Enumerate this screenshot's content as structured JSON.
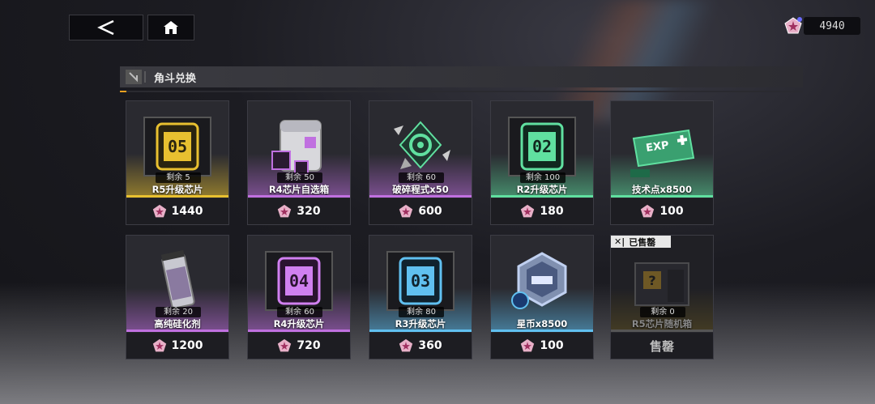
{
  "nav": {
    "back_icon": "chevron-left-icon",
    "home_icon": "home-icon"
  },
  "currency": {
    "icon": "pentagon-star-icon",
    "value": "4940"
  },
  "header": {
    "title": "角斗兑换"
  },
  "items": [
    {
      "name": "R5升级芯片",
      "stock": "剩余  5",
      "price": "1440",
      "color": "#e8c030",
      "icon": "chip-05-icon",
      "chip_label": "05"
    },
    {
      "name": "R4芯片自选箱",
      "stock": "剩余  50",
      "price": "320",
      "color": "#c070e0",
      "icon": "chip-box-icon"
    },
    {
      "name": "破碎程式x50",
      "stock": "剩余  60",
      "price": "600",
      "color": "#c070e0",
      "icon": "gear-shard-icon"
    },
    {
      "name": "R2升级芯片",
      "stock": "剩余  100",
      "price": "180",
      "color": "#60e0a0",
      "icon": "chip-02-icon",
      "chip_label": "02"
    },
    {
      "name": "技术点x8500",
      "stock": "",
      "price": "100",
      "color": "#60e0a0",
      "icon": "exp-ticket-icon",
      "exp_label": "EXP"
    },
    {
      "name": "高纯硅化剂",
      "stock": "剩余  20",
      "price": "1200",
      "color": "#c070e0",
      "icon": "silicon-vial-icon"
    },
    {
      "name": "R4升级芯片",
      "stock": "剩余  60",
      "price": "720",
      "color": "#c070e0",
      "icon": "chip-04-icon",
      "chip_label": "04"
    },
    {
      "name": "R3升级芯片",
      "stock": "剩余  80",
      "price": "360",
      "color": "#60c0f0",
      "icon": "chip-03-icon",
      "chip_label": "03"
    },
    {
      "name": "星币x8500",
      "stock": "",
      "price": "100",
      "color": "#60c0f0",
      "icon": "star-coin-icon"
    },
    {
      "name": "R5芯片随机箱",
      "stock": "剩余  0",
      "price": "售罄",
      "color": "#e8c030",
      "icon": "random-box-icon",
      "sold_out": true,
      "sold_out_tag": "已售罄"
    }
  ]
}
